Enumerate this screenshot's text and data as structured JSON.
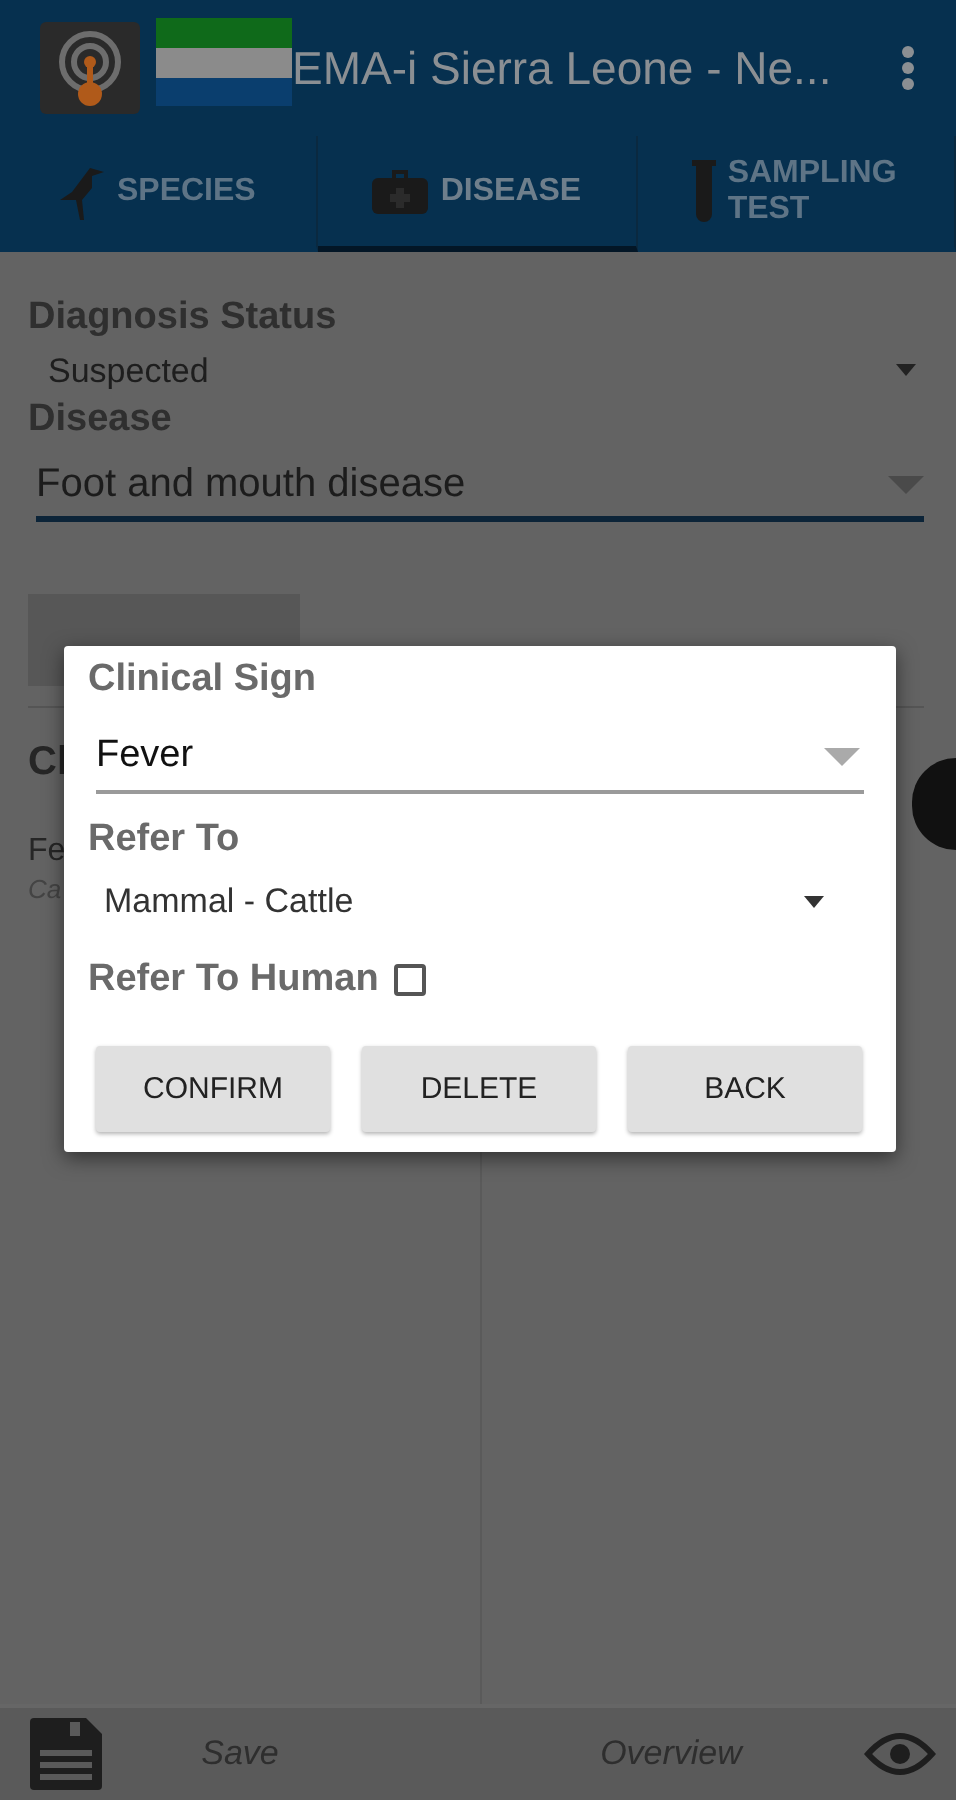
{
  "app_bar": {
    "title": "EMA-i Sierra Leone - Ne..."
  },
  "tabs": [
    {
      "label": "SPECIES",
      "selected": false
    },
    {
      "label": "DISEASE",
      "selected": true
    },
    {
      "label": "SAMPLING TEST",
      "selected": false
    }
  ],
  "form": {
    "diagnosis_status": {
      "label": "Diagnosis Status",
      "value": "Suspected"
    },
    "disease": {
      "label": "Disease",
      "value": "Foot and mouth disease"
    },
    "clinical_signs": {
      "heading": "Cl",
      "items": [
        {
          "name": "Fe",
          "detail": "Ca"
        }
      ]
    }
  },
  "dialog": {
    "clinical_sign": {
      "label": "Clinical Sign",
      "value": "Fever"
    },
    "refer_to": {
      "label": "Refer To",
      "value": "Mammal - Cattle"
    },
    "refer_to_human": {
      "label": "Refer To Human",
      "checked": false
    },
    "buttons": [
      "CONFIRM",
      "DELETE",
      "BACK"
    ]
  },
  "bottom_bar": {
    "save": "Save",
    "overview": "Overview"
  }
}
